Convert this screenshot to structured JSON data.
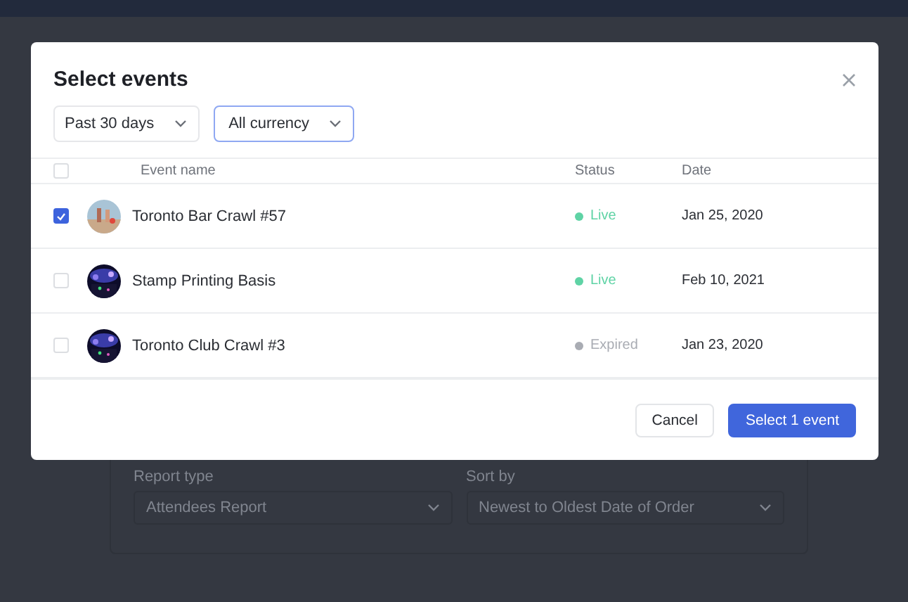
{
  "dialog": {
    "title": "Select events",
    "filters": [
      {
        "label": "Past 30 days",
        "focused": false
      },
      {
        "label": "All currency",
        "focused": true
      }
    ],
    "table": {
      "columns": [
        "Event name",
        "Status",
        "Date"
      ],
      "all_checked": false,
      "rows": [
        {
          "checked": true,
          "name": "Toronto Bar Crawl #57",
          "status": "Live",
          "color": "#5fd3a5",
          "date": "Jan 25, 2020"
        },
        {
          "checked": false,
          "name": "Stamp Printing Basis",
          "status": "Live",
          "color": "#5fd3a5",
          "date": "Feb 10, 2021"
        },
        {
          "checked": false,
          "name": "Toronto Club Crawl #3",
          "status": "Expired",
          "color": "#a9acb3",
          "date": "Jan 23, 2020"
        }
      ]
    },
    "buttons": [
      {
        "label": "Cancel",
        "kind": "secondary"
      },
      {
        "label": "Select 1 event",
        "kind": "primary"
      }
    ]
  },
  "background": {
    "fields": [
      {
        "label": "Report type",
        "value": "Attendees Report"
      },
      {
        "label": "Sort by",
        "value": "Newest to Oldest Date of Order"
      }
    ]
  }
}
